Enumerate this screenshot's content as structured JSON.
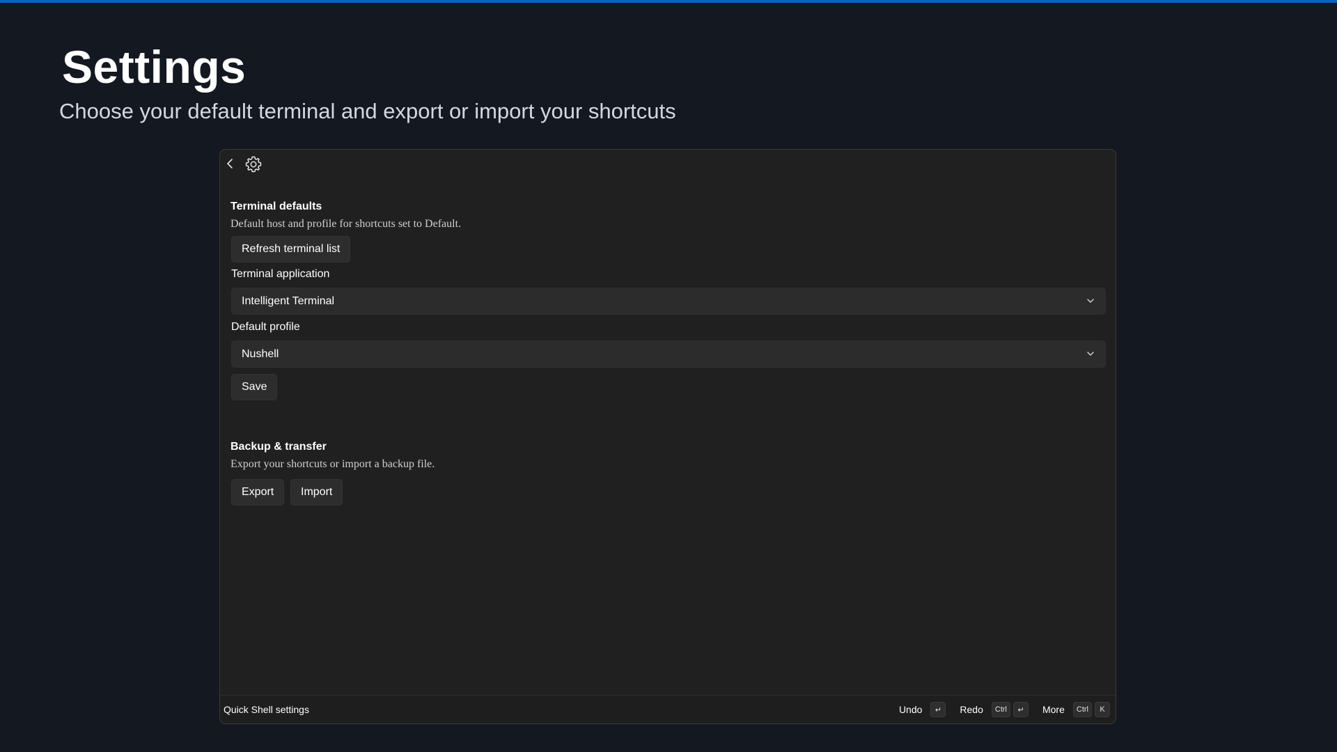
{
  "hero": {
    "title": "Settings",
    "subtitle": "Choose your default terminal and export or import your shortcuts"
  },
  "header": {
    "back_icon": "chevron-left-icon",
    "settings_icon": "gear-icon"
  },
  "terminal_defaults": {
    "title": "Terminal defaults",
    "description": "Default host and profile for shortcuts set to Default.",
    "refresh_label": "Refresh terminal list",
    "app_label": "Terminal application",
    "app_value": "Intelligent Terminal",
    "profile_label": "Default profile",
    "profile_value": "Nushell",
    "save_label": "Save"
  },
  "backup": {
    "title": "Backup & transfer",
    "description": "Export your shortcuts or import a backup file.",
    "export_label": "Export",
    "import_label": "Import"
  },
  "footer": {
    "title": "Quick Shell settings",
    "undo_label": "Undo",
    "undo_key": "↵",
    "redo_label": "Redo",
    "redo_key_1": "Ctrl",
    "redo_key_2": "↵",
    "more_label": "More",
    "more_key_1": "Ctrl",
    "more_key_2": "K"
  },
  "colors": {
    "background": "#141821",
    "accent": "#0a64c8",
    "panel": "#202020",
    "control": "#2c2c2c"
  }
}
